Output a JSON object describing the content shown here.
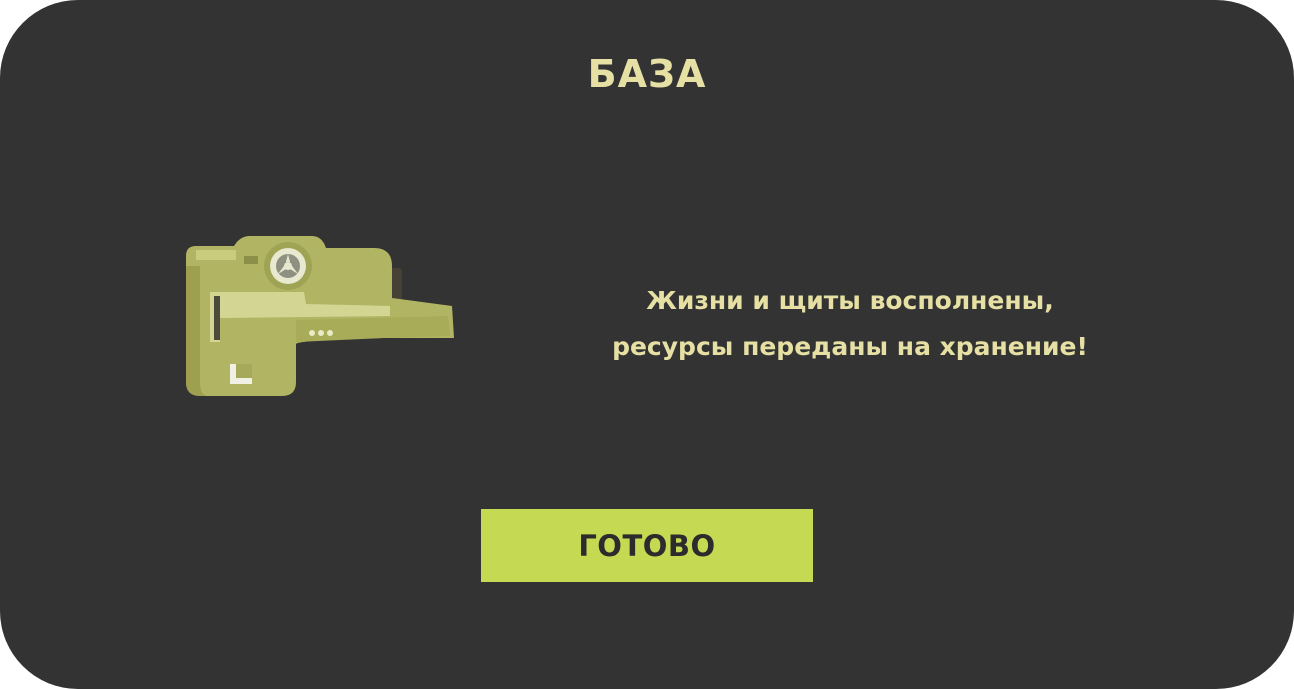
{
  "dialog": {
    "title": "БАЗА",
    "message_lines": [
      "Жизни и щиты восполнены,",
      "ресурсы переданы на хранение!"
    ],
    "done_label": "ГОТОВО",
    "base_icon": "space-base-icon"
  },
  "colors": {
    "background": "#333333",
    "text": "#e6e0a4",
    "button": "#c5da52",
    "button_text": "#2c2c2c"
  }
}
